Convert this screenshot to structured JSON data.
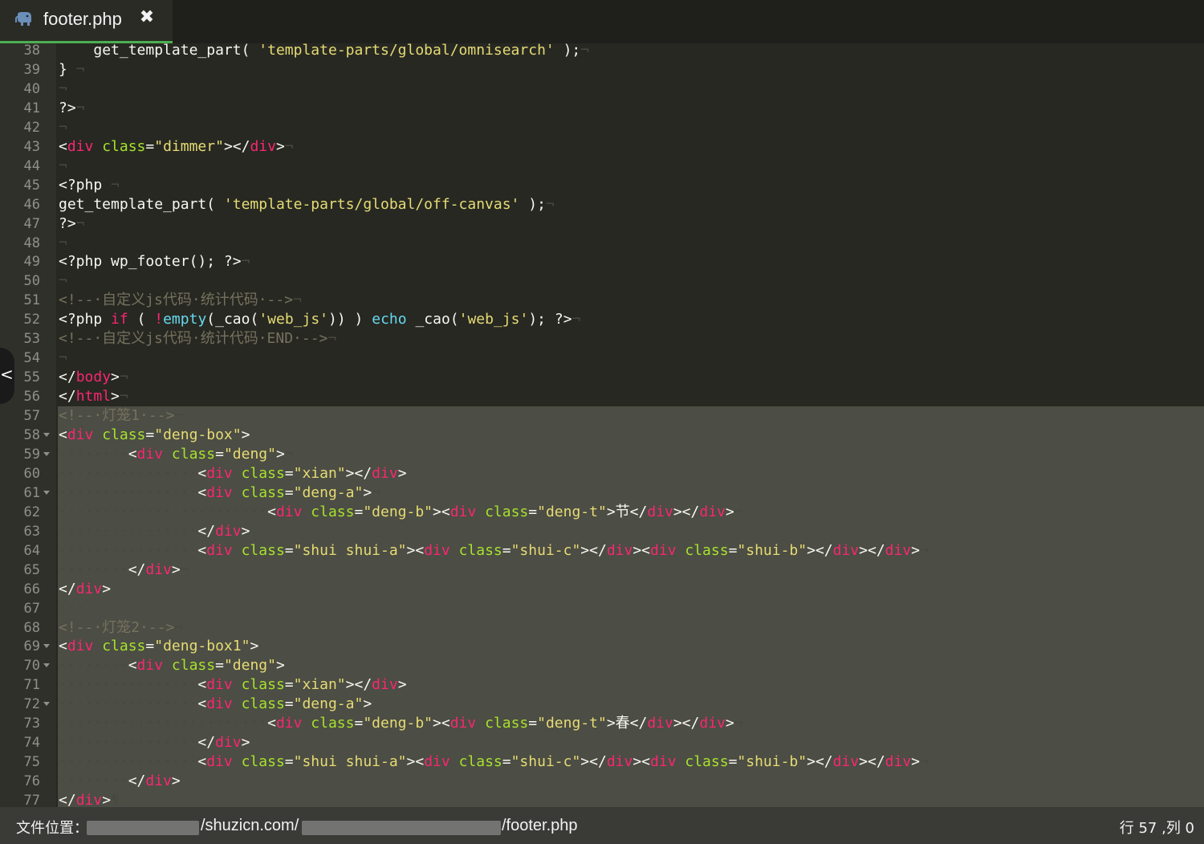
{
  "tab": {
    "title": "footer.php",
    "close_glyph": "✖",
    "icon": "php-elephant-icon"
  },
  "colors": {
    "background": "#272822",
    "gutter": "#2f302a",
    "selection": "#4c4d44",
    "tab_accent": "#4caf50",
    "tag": "#f92672",
    "attr": "#a6e22e",
    "string": "#e6db74",
    "comment": "#75715e",
    "keyword": "#66d9ef",
    "text": "#f8f8f2",
    "whitespace": "#49483e"
  },
  "editor": {
    "first_line": 38,
    "selection_from_line": 57,
    "selection_to_line": 77,
    "folds": [
      58,
      59,
      61,
      69,
      70,
      72
    ],
    "lines": [
      [
        [
          "    ",
          "ws"
        ],
        [
          "get_template_part(",
          "t"
        ],
        [
          " ",
          "ws"
        ],
        [
          "'template-parts/global/omnisearch'",
          "s"
        ],
        [
          " ",
          "ws"
        ],
        [
          ");",
          "t"
        ],
        [
          "¬",
          "ws"
        ]
      ],
      [
        [
          "}",
          "t"
        ],
        [
          " ¬",
          "ws"
        ]
      ],
      [
        [
          "¬",
          "ws"
        ]
      ],
      [
        [
          "?>",
          "t"
        ],
        [
          "¬",
          "ws"
        ]
      ],
      [
        [
          "¬",
          "ws"
        ]
      ],
      [
        [
          "<",
          "t"
        ],
        [
          "div",
          "k"
        ],
        [
          " ",
          "ws"
        ],
        [
          "class",
          "a"
        ],
        [
          "=",
          "t"
        ],
        [
          "\"dimmer\"",
          "s"
        ],
        [
          "></",
          "t"
        ],
        [
          "div",
          "k"
        ],
        [
          ">",
          "t"
        ],
        [
          "¬",
          "ws"
        ]
      ],
      [
        [
          "¬",
          "ws"
        ]
      ],
      [
        [
          "<?php",
          "t"
        ],
        [
          " ¬",
          "ws"
        ]
      ],
      [
        [
          "get_template_part(",
          "t"
        ],
        [
          " ",
          "ws"
        ],
        [
          "'template-parts/global/off-canvas'",
          "s"
        ],
        [
          " ",
          "ws"
        ],
        [
          ");",
          "t"
        ],
        [
          "¬",
          "ws"
        ]
      ],
      [
        [
          "?>",
          "t"
        ],
        [
          "¬",
          "ws"
        ]
      ],
      [
        [
          "¬",
          "ws"
        ]
      ],
      [
        [
          "<?php",
          "t"
        ],
        [
          " ",
          "ws"
        ],
        [
          "wp_footer();",
          "t"
        ],
        [
          " ",
          "ws"
        ],
        [
          "?>",
          "t"
        ],
        [
          "¬",
          "ws"
        ]
      ],
      [
        [
          "¬",
          "ws"
        ]
      ],
      [
        [
          "<!--·自定义js代码·统计代码·-->",
          "c"
        ],
        [
          "¬",
          "ws"
        ]
      ],
      [
        [
          "<?php",
          "t"
        ],
        [
          " ",
          "ws"
        ],
        [
          "if",
          "k"
        ],
        [
          " ",
          "ws"
        ],
        [
          "(",
          "t"
        ],
        [
          " ",
          "ws"
        ],
        [
          "!",
          "k"
        ],
        [
          "empty",
          "b"
        ],
        [
          "(_cao(",
          "t"
        ],
        [
          "'web_js'",
          "s"
        ],
        [
          "))",
          "t"
        ],
        [
          " ",
          "ws"
        ],
        [
          ")",
          "t"
        ],
        [
          " ",
          "ws"
        ],
        [
          "echo",
          "b"
        ],
        [
          " ",
          "ws"
        ],
        [
          "_cao(",
          "t"
        ],
        [
          "'web_js'",
          "s"
        ],
        [
          ");",
          "t"
        ],
        [
          " ",
          "ws"
        ],
        [
          "?>",
          "t"
        ],
        [
          "¬",
          "ws"
        ]
      ],
      [
        [
          "<!--·自定义js代码·统计代码·END·-->",
          "c"
        ],
        [
          "¬",
          "ws"
        ]
      ],
      [
        [
          "¬",
          "ws"
        ]
      ],
      [
        [
          "</",
          "t"
        ],
        [
          "body",
          "k"
        ],
        [
          ">",
          "t"
        ],
        [
          "¬",
          "ws"
        ]
      ],
      [
        [
          "</",
          "t"
        ],
        [
          "html",
          "k"
        ],
        [
          ">",
          "t"
        ],
        [
          "¬",
          "ws"
        ]
      ],
      [
        [
          "<!--·灯笼1·-->",
          "c"
        ],
        [
          "¬",
          "ws"
        ]
      ],
      [
        [
          "<",
          "t"
        ],
        [
          "div",
          "k"
        ],
        [
          " ",
          "ws"
        ],
        [
          "class",
          "a"
        ],
        [
          "=",
          "t"
        ],
        [
          "\"deng-box\"",
          "s"
        ],
        [
          ">",
          "t"
        ]
      ],
      [
        [
          "········",
          "ws"
        ],
        [
          "<",
          "t"
        ],
        [
          "div",
          "k"
        ],
        [
          " ",
          "ws"
        ],
        [
          "class",
          "a"
        ],
        [
          "=",
          "t"
        ],
        [
          "\"deng\"",
          "s"
        ],
        [
          ">",
          "t"
        ],
        [
          "¬",
          "ws"
        ]
      ],
      [
        [
          "················",
          "ws"
        ],
        [
          "<",
          "t"
        ],
        [
          "div",
          "k"
        ],
        [
          " ",
          "ws"
        ],
        [
          "class",
          "a"
        ],
        [
          "=",
          "t"
        ],
        [
          "\"xian\"",
          "s"
        ],
        [
          "></",
          "t"
        ],
        [
          "div",
          "k"
        ],
        [
          ">",
          "t"
        ]
      ],
      [
        [
          "················",
          "ws"
        ],
        [
          "<",
          "t"
        ],
        [
          "div",
          "k"
        ],
        [
          " ",
          "ws"
        ],
        [
          "class",
          "a"
        ],
        [
          "=",
          "t"
        ],
        [
          "\"deng-a\"",
          "s"
        ],
        [
          ">",
          "t"
        ],
        [
          "¬",
          "ws"
        ]
      ],
      [
        [
          "························",
          "ws"
        ],
        [
          "<",
          "t"
        ],
        [
          "div",
          "k"
        ],
        [
          " ",
          "ws"
        ],
        [
          "class",
          "a"
        ],
        [
          "=",
          "t"
        ],
        [
          "\"deng-b\"",
          "s"
        ],
        [
          "><",
          "t"
        ],
        [
          "div",
          "k"
        ],
        [
          " ",
          "ws"
        ],
        [
          "class",
          "a"
        ],
        [
          "=",
          "t"
        ],
        [
          "\"deng-t\"",
          "s"
        ],
        [
          ">节</",
          "t"
        ],
        [
          "div",
          "k"
        ],
        [
          "></",
          "t"
        ],
        [
          "div",
          "k"
        ],
        [
          ">",
          "t"
        ],
        [
          "¬",
          "ws"
        ]
      ],
      [
        [
          "················",
          "ws"
        ],
        [
          "</",
          "t"
        ],
        [
          "div",
          "k"
        ],
        [
          ">",
          "t"
        ]
      ],
      [
        [
          "················",
          "ws"
        ],
        [
          "<",
          "t"
        ],
        [
          "div",
          "k"
        ],
        [
          " ",
          "ws"
        ],
        [
          "class",
          "a"
        ],
        [
          "=",
          "t"
        ],
        [
          "\"shui shui-a\"",
          "s"
        ],
        [
          "><",
          "t"
        ],
        [
          "div",
          "k"
        ],
        [
          " ",
          "ws"
        ],
        [
          "class",
          "a"
        ],
        [
          "=",
          "t"
        ],
        [
          "\"shui-c\"",
          "s"
        ],
        [
          "></",
          "t"
        ],
        [
          "div",
          "k"
        ],
        [
          "><",
          "t"
        ],
        [
          "div",
          "k"
        ],
        [
          " ",
          "ws"
        ],
        [
          "class",
          "a"
        ],
        [
          "=",
          "t"
        ],
        [
          "\"shui-b\"",
          "s"
        ],
        [
          "></",
          "t"
        ],
        [
          "div",
          "k"
        ],
        [
          "></",
          "t"
        ],
        [
          "div",
          "k"
        ],
        [
          ">",
          "t"
        ],
        [
          "¬",
          "ws"
        ]
      ],
      [
        [
          "········",
          "ws"
        ],
        [
          "</",
          "t"
        ],
        [
          "div",
          "k"
        ],
        [
          ">",
          "t"
        ],
        [
          "¬",
          "ws"
        ]
      ],
      [
        [
          "</",
          "t"
        ],
        [
          "div",
          "k"
        ],
        [
          ">",
          "t"
        ]
      ],
      [
        [
          "···",
          "ws"
        ]
      ],
      [
        [
          "<!--·灯笼2·-->",
          "c"
        ],
        [
          "¬",
          "ws"
        ]
      ],
      [
        [
          "<",
          "t"
        ],
        [
          "div",
          "k"
        ],
        [
          " ",
          "ws"
        ],
        [
          "class",
          "a"
        ],
        [
          "=",
          "t"
        ],
        [
          "\"deng-box1\"",
          "s"
        ],
        [
          ">",
          "t"
        ]
      ],
      [
        [
          "········",
          "ws"
        ],
        [
          "<",
          "t"
        ],
        [
          "div",
          "k"
        ],
        [
          " ",
          "ws"
        ],
        [
          "class",
          "a"
        ],
        [
          "=",
          "t"
        ],
        [
          "\"deng\"",
          "s"
        ],
        [
          ">",
          "t"
        ]
      ],
      [
        [
          "················",
          "ws"
        ],
        [
          "<",
          "t"
        ],
        [
          "div",
          "k"
        ],
        [
          " ",
          "ws"
        ],
        [
          "class",
          "a"
        ],
        [
          "=",
          "t"
        ],
        [
          "\"xian\"",
          "s"
        ],
        [
          "></",
          "t"
        ],
        [
          "div",
          "k"
        ],
        [
          ">",
          "t"
        ]
      ],
      [
        [
          "················",
          "ws"
        ],
        [
          "<",
          "t"
        ],
        [
          "div",
          "k"
        ],
        [
          " ",
          "ws"
        ],
        [
          "class",
          "a"
        ],
        [
          "=",
          "t"
        ],
        [
          "\"deng-a\"",
          "s"
        ],
        [
          ">",
          "t"
        ]
      ],
      [
        [
          "························",
          "ws"
        ],
        [
          "<",
          "t"
        ],
        [
          "div",
          "k"
        ],
        [
          " ",
          "ws"
        ],
        [
          "class",
          "a"
        ],
        [
          "=",
          "t"
        ],
        [
          "\"deng-b\"",
          "s"
        ],
        [
          "><",
          "t"
        ],
        [
          "div",
          "k"
        ],
        [
          " ",
          "ws"
        ],
        [
          "class",
          "a"
        ],
        [
          "=",
          "t"
        ],
        [
          "\"deng-t\"",
          "s"
        ],
        [
          ">春</",
          "t"
        ],
        [
          "div",
          "k"
        ],
        [
          "></",
          "t"
        ],
        [
          "div",
          "k"
        ],
        [
          ">",
          "t"
        ],
        [
          "¬",
          "ws"
        ]
      ],
      [
        [
          "················",
          "ws"
        ],
        [
          "</",
          "t"
        ],
        [
          "div",
          "k"
        ],
        [
          ">",
          "t"
        ]
      ],
      [
        [
          "················",
          "ws"
        ],
        [
          "<",
          "t"
        ],
        [
          "div",
          "k"
        ],
        [
          " ",
          "ws"
        ],
        [
          "class",
          "a"
        ],
        [
          "=",
          "t"
        ],
        [
          "\"shui shui-a\"",
          "s"
        ],
        [
          "><",
          "t"
        ],
        [
          "div",
          "k"
        ],
        [
          " ",
          "ws"
        ],
        [
          "class",
          "a"
        ],
        [
          "=",
          "t"
        ],
        [
          "\"shui-c\"",
          "s"
        ],
        [
          "></",
          "t"
        ],
        [
          "div",
          "k"
        ],
        [
          "><",
          "t"
        ],
        [
          "div",
          "k"
        ],
        [
          " ",
          "ws"
        ],
        [
          "class",
          "a"
        ],
        [
          "=",
          "t"
        ],
        [
          "\"shui-b\"",
          "s"
        ],
        [
          "></",
          "t"
        ],
        [
          "div",
          "k"
        ],
        [
          "></",
          "t"
        ],
        [
          "div",
          "k"
        ],
        [
          ">",
          "t"
        ],
        [
          "¬",
          "ws"
        ]
      ],
      [
        [
          "········",
          "ws"
        ],
        [
          "</",
          "t"
        ],
        [
          "div",
          "k"
        ],
        [
          ">",
          "t"
        ]
      ],
      [
        [
          "</",
          "t"
        ],
        [
          "div",
          "k"
        ],
        [
          ">",
          "t"
        ],
        [
          "¶",
          "ws"
        ]
      ]
    ]
  },
  "status": {
    "label": "文件位置：",
    "path_middle": "/shuzicn.com/",
    "path_end": "/footer.php",
    "position": "行 57 ,列 0"
  }
}
